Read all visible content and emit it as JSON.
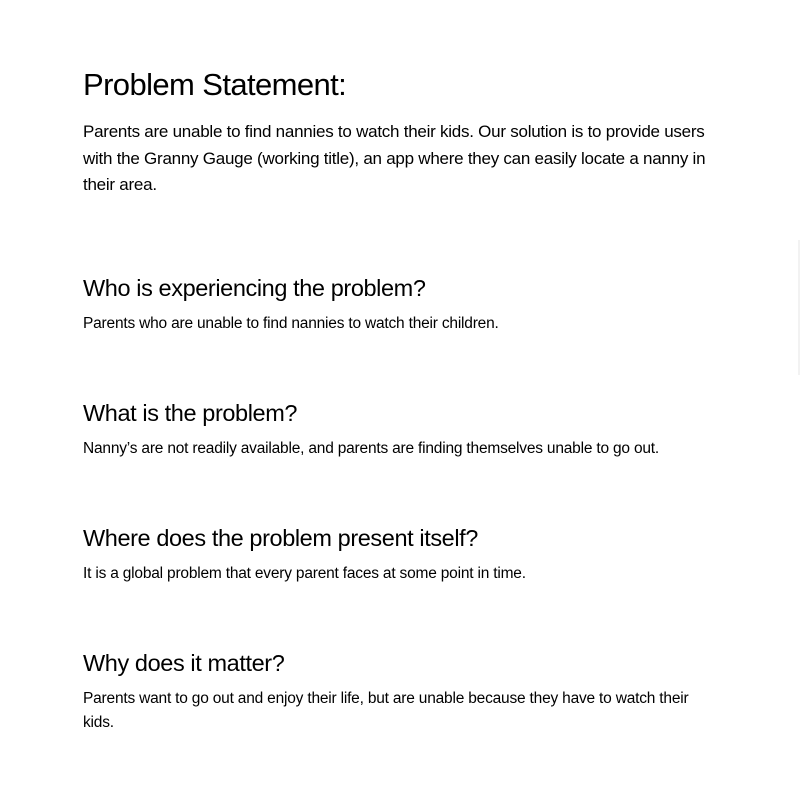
{
  "document": {
    "title": "Problem Statement:",
    "intro": "Parents are unable to find nannies to watch their kids. Our solution is to provide users with the Granny Gauge (working title), an app where they can easily locate a nanny in their area.",
    "sections": [
      {
        "heading": "Who is experiencing the problem?",
        "body": "Parents who are unable to find nannies to watch their children."
      },
      {
        "heading": "What is the problem?",
        "body": "Nanny’s are not readily available, and parents are finding themselves unable to go out."
      },
      {
        "heading": "Where does the problem present itself?",
        "body": "It is a global problem that every parent faces at some point in time."
      },
      {
        "heading": "Why does it matter?",
        "body": "Parents want to go out and enjoy their life, but are unable because they have to watch their kids."
      }
    ]
  }
}
